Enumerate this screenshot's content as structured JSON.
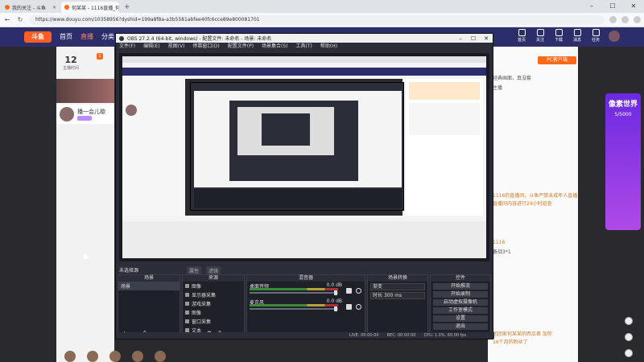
{
  "browser": {
    "tabs": [
      {
        "label": "我的关注 - 斗鱼",
        "active": false
      },
      {
        "label": "何某某 - 1116直播_何某某 - 1116",
        "active": true
      }
    ],
    "url": "https://www.douyu.com/10358956?dyshid=199a8f8a-a3b5581abfee40fc6cce89e800081701"
  },
  "douyu": {
    "logo": "斗鱼",
    "menu": [
      "首页",
      "直播",
      "分类"
    ],
    "active_menu": "直播",
    "right_icons": [
      "首页",
      "关注",
      "下载",
      "消息",
      "任务"
    ],
    "follow_count": "12",
    "follow_label": "主播时间",
    "badge": "1",
    "streamer_name": "播一会儿歇",
    "pc_button": "PC客户端",
    "right_texts": [
      "经典画面，真没套",
      "主播",
      "1116的直播间，斗鱼严禁未成年人直播",
      "直播间内容进行24小时巡查",
      "1116",
      "备战3*1",
      "团团家何某某的西瓜君 加你",
      "16个月的粉丝了"
    ],
    "ad_title": "像素世界",
    "ad_sub": "5/5000"
  },
  "obs": {
    "title": "OBS 27.2.4 (64-bit, windows) - 配置文件: 未命名 - 场景: 未命名",
    "menu": [
      "文件(F)",
      "编辑(E)",
      "视图(V)",
      "停靠窗口(D)",
      "配置文件(P)",
      "场景集合(S)",
      "工具(T)",
      "帮助(H)"
    ],
    "stream_label": "未选择源",
    "control_tabs": [
      "属性",
      "滤镜"
    ],
    "docks": {
      "scenes": {
        "header": "场景",
        "items": [
          "场景"
        ]
      },
      "sources": {
        "header": "来源",
        "items": [
          "图像",
          "显示器采集",
          "游戏采集",
          "图像",
          "窗口采集",
          "文本"
        ]
      },
      "mixer": {
        "header": "混音器",
        "channels": [
          {
            "name": "桌面音频",
            "db": "0.0 dB"
          },
          {
            "name": "麦克风",
            "db": "0.0 dB"
          }
        ]
      },
      "transitions": {
        "header": "场景转换",
        "type": "渐变",
        "duration_label": "时长",
        "duration": "300 ms"
      },
      "controls": {
        "header": "控件",
        "buttons": [
          "开始推流",
          "开始录制",
          "启动虚拟摄像机",
          "工作室模式",
          "设置",
          "退出"
        ]
      }
    },
    "status": [
      "LIVE: 00:00:00",
      "REC: 00:00:00",
      "CPU: 1.0%, 60.00 fps"
    ]
  }
}
